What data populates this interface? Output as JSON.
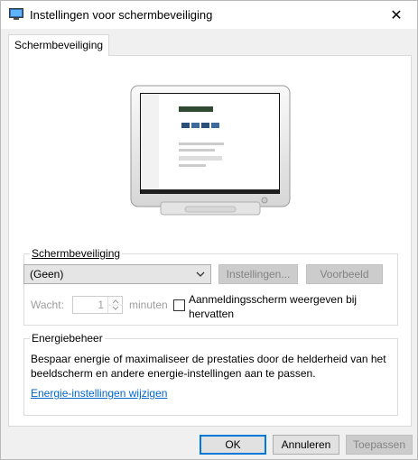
{
  "window": {
    "title": "Instellingen voor schermbeveiliging",
    "icon": "monitor-app-icon",
    "close_glyph": "✕"
  },
  "tab": {
    "label": "Schermbeveiliging"
  },
  "screensaver": {
    "group_label": "Schermbeveiliging",
    "selected": "(Geen)",
    "settings_button": "Instellingen...",
    "preview_button": "Voorbeeld",
    "wait_label": "Wacht:",
    "wait_value": "1",
    "minutes_label": "minuten",
    "logon_checkbox_label_line1": "Aanmeldingsscherm weergeven bij",
    "logon_checkbox_label_line2": "hervatten",
    "logon_checked": false
  },
  "power": {
    "group_label": "Energiebeheer",
    "description_line1": "Bespaar energie of maximaliseer de prestaties door de helderheid van het",
    "description_line2": "beeldscherm en andere energie-instellingen aan te passen.",
    "link": "Energie-instellingen wijzigen"
  },
  "buttons": {
    "ok": "OK",
    "cancel": "Annuleren",
    "apply": "Toepassen"
  },
  "colors": {
    "link": "#0066cc",
    "accent": "#0078d7",
    "disabled_text": "#838383"
  }
}
